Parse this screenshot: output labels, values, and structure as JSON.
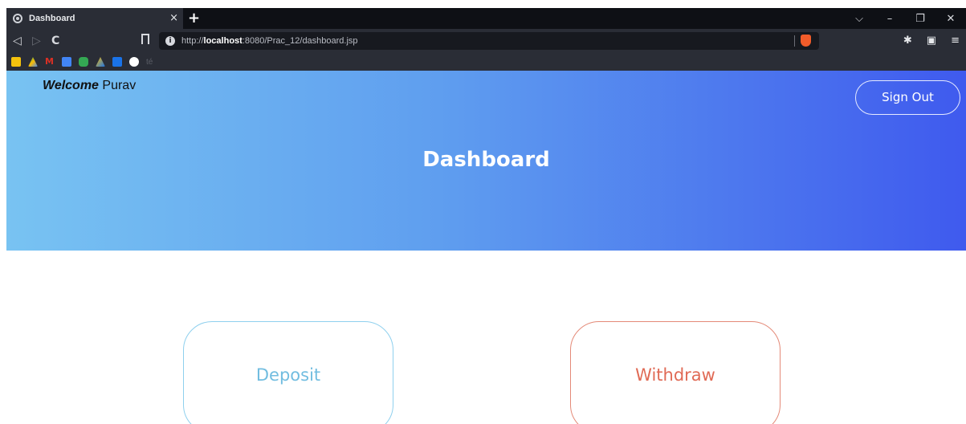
{
  "browser": {
    "tab_title": "Dashboard",
    "tab_close": "×",
    "new_tab": "+",
    "url_scheme": "http://",
    "url_host": "localhost",
    "url_path": ":8080/Prac_12/dashboard.jsp",
    "window_controls": {
      "tabsearch": "⌵",
      "minimize": "–",
      "restore": "❐",
      "close": "✕"
    },
    "nav": {
      "back": "◁",
      "forward": "▷",
      "reload": "C"
    },
    "extensions": {
      "puzzle": "✱",
      "wallet": "▣",
      "menu": "≡"
    },
    "bookmark_colors": [
      "#f4c20d",
      "#1ea362",
      "#d93025",
      "#4285f4",
      "#34a853",
      "#fbbc04",
      "#1a73e8",
      "#ffffff"
    ],
    "bookmark_text": "té"
  },
  "page": {
    "welcome_bold": "Welcome",
    "welcome_name": "Purav",
    "signout_label": "Sign Out",
    "title": "Dashboard",
    "deposit_label": "Deposit",
    "withdraw_label": "Withdraw"
  },
  "colors": {
    "gradient_start": "#78c3f2",
    "gradient_end": "#3f5aee",
    "deposit": "#72bde0",
    "withdraw": "#e06a55"
  }
}
